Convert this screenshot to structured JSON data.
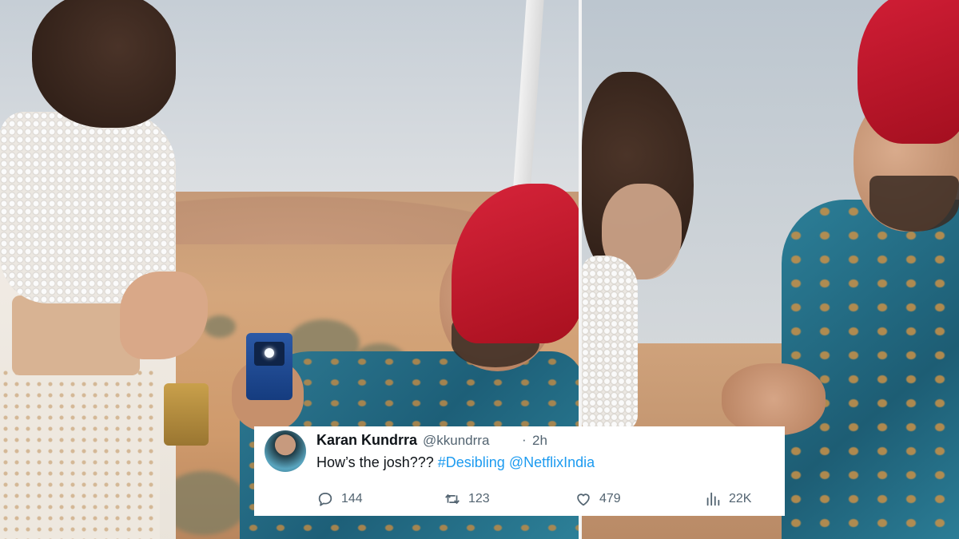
{
  "tweet": {
    "author_name": "Karan Kundrra",
    "handle": "@kkundrra",
    "separator": "·",
    "time": "2h",
    "text_prefix": "How’s the josh??? ",
    "hashtag": "#Desibling",
    "mention": "@NetflixIndia",
    "replies": "144",
    "retweets": "123",
    "likes": "479",
    "views": "22K"
  },
  "icons": {
    "reply": "reply-icon",
    "retweet": "retweet-icon",
    "like": "heart-icon",
    "views": "views-icon"
  },
  "colors": {
    "link": "#1d9bf0",
    "secondary_text": "#536471",
    "primary_text": "#0f1419"
  }
}
